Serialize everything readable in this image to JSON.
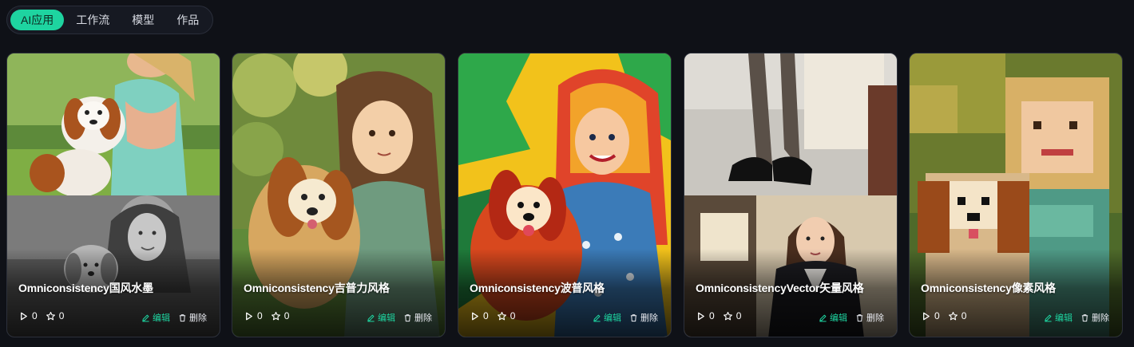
{
  "tabs": [
    {
      "label": "AI应用",
      "active": true
    },
    {
      "label": "工作流",
      "active": false
    },
    {
      "label": "模型",
      "active": false
    },
    {
      "label": "作品",
      "active": false
    }
  ],
  "cards": [
    {
      "title": "Omniconsistency国风水墨",
      "runs": "0",
      "stars": "0",
      "edit_label": "编辑",
      "delete_label": "删除"
    },
    {
      "title": "Omniconsistency吉普力风格",
      "runs": "0",
      "stars": "0",
      "edit_label": "编辑",
      "delete_label": "删除"
    },
    {
      "title": "Omniconsistency波普风格",
      "runs": "0",
      "stars": "0",
      "edit_label": "编辑",
      "delete_label": "删除"
    },
    {
      "title": "OmniconsistencyVector矢量风格",
      "runs": "0",
      "stars": "0",
      "edit_label": "编辑",
      "delete_label": "删除"
    },
    {
      "title": "Omniconsistency像素风格",
      "runs": "0",
      "stars": "0",
      "edit_label": "编辑",
      "delete_label": "删除"
    }
  ],
  "icons": {
    "play": "play-icon",
    "star": "star-icon",
    "edit": "pencil-icon",
    "delete": "trash-icon"
  },
  "colors": {
    "background": "#0f1117",
    "accent": "#1ed4a0",
    "card_border": "#2c303b"
  }
}
